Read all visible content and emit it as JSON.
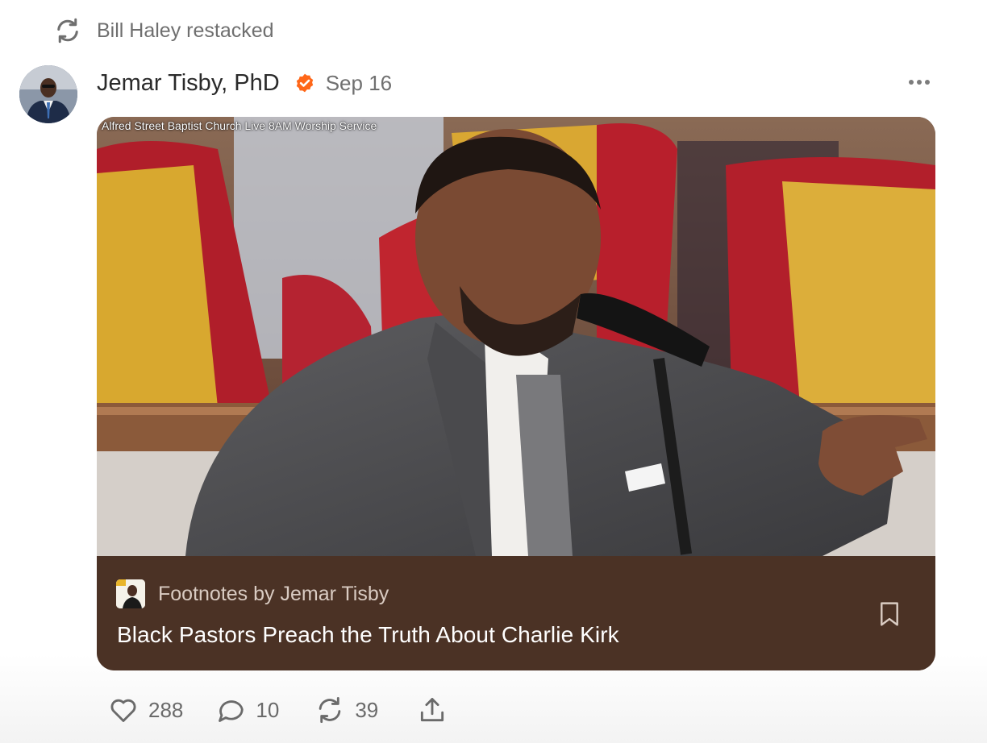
{
  "restack": {
    "icon": "restack-icon",
    "text": "Bill Haley restacked"
  },
  "post": {
    "author": "Jemar Tisby, PhD",
    "verified_icon": "verified-check-icon",
    "verified_color": "#ff6719",
    "date": "Sep 16",
    "more_icon": "more-horizontal-icon"
  },
  "card": {
    "video_caption": "Alfred Street Baptist Church Live 8AM Worship Service",
    "publication": "Footnotes by Jemar Tisby",
    "title": "Black Pastors Preach the Truth About Charlie Kirk",
    "bookmark_icon": "bookmark-icon",
    "footer_color": "#4b3225"
  },
  "actions": {
    "likes": "288",
    "comments": "10",
    "restacks": "39",
    "share_icon": "share-icon"
  }
}
